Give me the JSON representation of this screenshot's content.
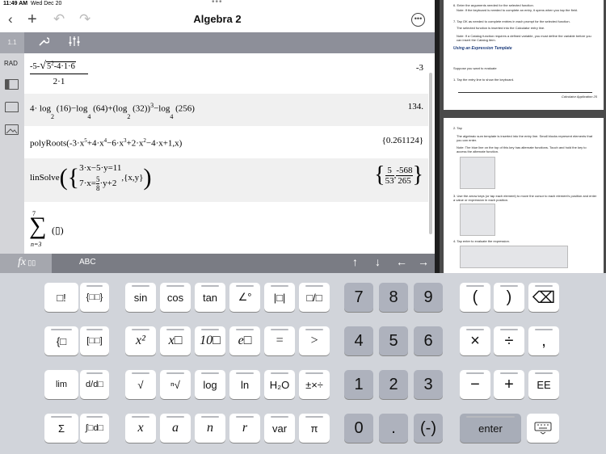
{
  "status": {
    "time": "11:49 AM",
    "date": "Wed Dec 20"
  },
  "nav": {
    "title": "Algebra 2",
    "back_icon": "chevron-left-icon",
    "add_icon": "plus-icon",
    "undo_icon": "undo-icon",
    "redo_icon": "redo-icon",
    "more_icon": "more-icon"
  },
  "toolbar": {
    "page": "1.1",
    "tools_icon": "wrench-icon",
    "settings_icon": "sliders-icon"
  },
  "sidebar": {
    "mode": "RAD"
  },
  "history": [
    {
      "expr": "-5-√(5²-4·1·6) / 2·1",
      "result": "-3"
    },
    {
      "expr": "4·log₂(16)−log₄(64)+(log₂(32))³−log₄(256)",
      "result": "134."
    },
    {
      "expr": "polyRoots(-3·x⁵+4·x⁴−6·x³+2·x²−4·x+1,x)",
      "result": "{0.261124}"
    },
    {
      "expr": "linSolve({3·x−5·y=11 ; 7·x=5/8·y+2},{x,y})",
      "result": "{5/53, -568/265}"
    }
  ],
  "entry_line": {
    "upper": "7",
    "lower": "n=3"
  },
  "kbbar": {
    "tab_fx": "fx",
    "tab_abc": "ABC",
    "arrows": [
      "↑",
      "↓",
      "←",
      "→"
    ]
  },
  "doc": {
    "page1": [
      "6.  Enter the arguments needed for the selected function.",
      "Note: If the keyboard is needed to complete an entry, it opens when you tap the field.",
      "7.  Tap OK as needed to complete entries in each prompt for the selected function.",
      "The selected function is inserted into the Calculator entry line.",
      "Note: If a Catalog function requires a defined variable, you must define the variable before you can insert the Catalog item.",
      "Using an Expression Template",
      "Suppose you want to evaluate",
      "1.  Tap the entry line to show the keyboard.",
      "Calculator Application    25"
    ],
    "page2": [
      "2.  Tap",
      "The algebraic sum template is inserted into the entry line. Small blocks represent elements that you can enter.",
      "Note: The blue line on the top of this key has alternate functions. Touch and hold the key to access the alternate function.",
      "3.  Use the arrow keys (or tap each element) to move the cursor to each element's position and enter a value or expression in each position.",
      "4.  Tap enter to evaluate the expression."
    ]
  },
  "keys": {
    "left": [
      "□!",
      "{□□}",
      "{□",
      "[□□]",
      "lim",
      "d/d□",
      "Σ",
      "∫□d□"
    ],
    "middle": [
      [
        "sin",
        "cos",
        "tan",
        "∠°",
        "|□|",
        "□/□"
      ],
      [
        "x²",
        "x□",
        "10□",
        "e□",
        "=",
        ">"
      ],
      [
        "√",
        "ⁿ√",
        "log",
        "ln",
        "H₂O",
        "±×÷"
      ],
      [
        "x",
        "a",
        "n",
        "r",
        "var",
        "π"
      ]
    ],
    "numpad": [
      [
        "7",
        "8",
        "9"
      ],
      [
        "4",
        "5",
        "6"
      ],
      [
        "1",
        "2",
        "3"
      ],
      [
        "0",
        ".",
        "(-)"
      ]
    ],
    "ops": [
      [
        "(",
        ")",
        "⌫"
      ],
      [
        "×",
        "÷",
        ","
      ],
      [
        "−",
        "+",
        "EE"
      ]
    ],
    "enter": "enter",
    "keyboard_icon": "keyboard-icon"
  }
}
